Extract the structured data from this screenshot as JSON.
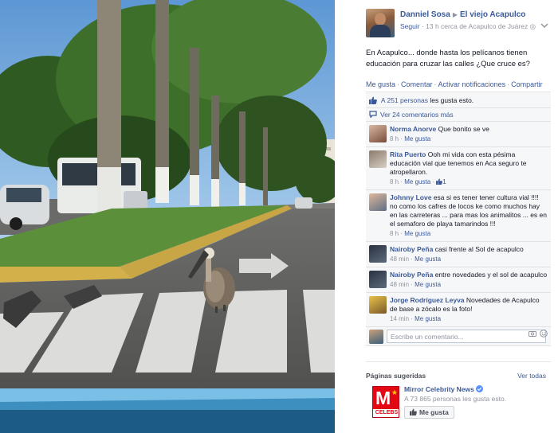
{
  "photo": {
    "alt_subject": "pelican-crossing-street"
  },
  "post": {
    "author": "Danniel Sosa",
    "page": "El viejo Acapulco",
    "follow": "Seguir",
    "meta": "13 h cerca de Acapulco de Juárez",
    "text": "En Acapulco... donde hasta los pelícanos tienen educación para cruzar las calles ¿Que cruce es?",
    "actions": {
      "like": "Me gusta",
      "comment": "Comentar",
      "notify": "Activar notificaciones",
      "share": "Compartir"
    },
    "likes_count": "A 251 personas",
    "likes_suffix": "les gusta esto.",
    "more_comments": "Ver 24 comentarios más"
  },
  "comments": [
    {
      "name": "Norma Anorve",
      "text": "Que bonito se ve",
      "time": "8 h",
      "like": "Me gusta",
      "likes": ""
    },
    {
      "name": "Rita Puerto",
      "text": "Ooh mi vida con esta pésima educación vial que tenemos en Aca seguro te atropellaron.",
      "time": "8 h",
      "like": "Me gusta",
      "likes": "1"
    },
    {
      "name": "Johnny Love",
      "text": "esa si es tener tener cultura vial !!!! no como los cafres de locos ke como muchos hay en las carreteras ... para mas los animalitos ... es en el semaforo de playa tamarindos !!!",
      "time": "8 h",
      "like": "Me gusta",
      "likes": ""
    },
    {
      "name": "Nairoby Peña",
      "text": "casi frente al Sol de acapulco",
      "time": "48 min",
      "like": "Me gusta",
      "likes": ""
    },
    {
      "name": "Nairoby Peña",
      "text": "entre novedades y el sol de acapulco",
      "time": "48 min",
      "like": "Me gusta",
      "likes": ""
    },
    {
      "name": "Jorge Rodríguez Leyva",
      "text": "Novedades de Acapulco de base a zócalo es la foto!",
      "time": "14 min",
      "like": "Me gusta",
      "likes": ""
    }
  ],
  "write_comment": {
    "placeholder": "Escribe un comentario..."
  },
  "suggested": {
    "title": "Páginas sugeridas",
    "see_all": "Ver todas",
    "page_name": "Mirror Celebrity News",
    "page_likes": "A 73 865 personas les gusta esto.",
    "like_button": "Me gusta",
    "logo_letter": "M",
    "logo_text": "CELEBS"
  },
  "colors": {
    "link": "#3b5998",
    "meta": "#90949c",
    "ufi_bg": "#f6f7f9",
    "brand_red": "#e30613"
  }
}
